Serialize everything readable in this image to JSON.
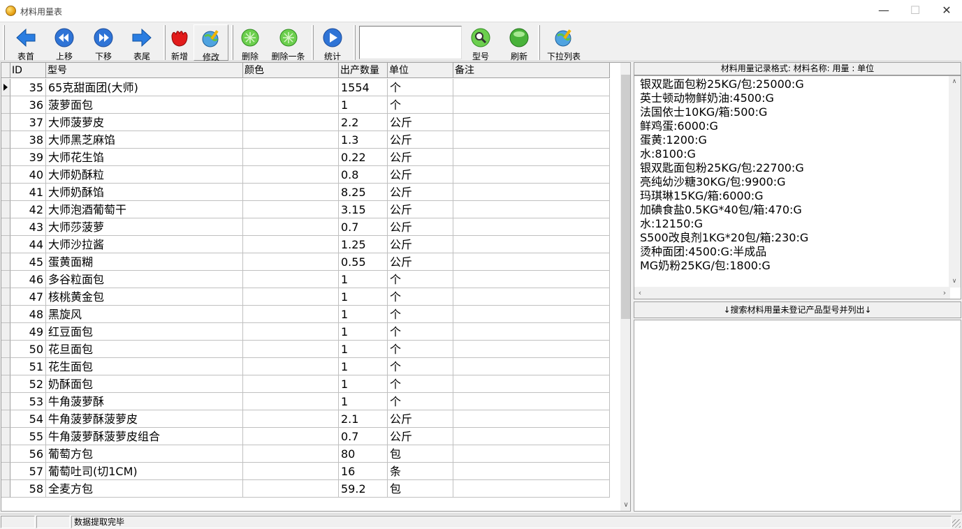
{
  "window": {
    "title": "材料用量表"
  },
  "toolbar": {
    "buttons": [
      {
        "label": "表首"
      },
      {
        "label": "上移"
      },
      {
        "label": "下移"
      },
      {
        "label": "表尾"
      },
      {
        "label": "新增"
      },
      {
        "label": "修改"
      },
      {
        "label": "删除"
      },
      {
        "label": "删除一条"
      },
      {
        "label": "统计"
      },
      {
        "label": "型号"
      },
      {
        "label": "刷新"
      },
      {
        "label": "下拉列表"
      }
    ],
    "search_value": ""
  },
  "grid": {
    "columns": [
      "ID",
      "型号",
      "颜色",
      "出产数量",
      "单位",
      "备注"
    ],
    "rows": [
      {
        "id": "35",
        "model": "65克甜面团(大师)",
        "color": "",
        "qty": "1554",
        "unit": "个",
        "note": ""
      },
      {
        "id": "36",
        "model": "菠萝面包",
        "color": "",
        "qty": "1",
        "unit": "个",
        "note": ""
      },
      {
        "id": "37",
        "model": "大师菠萝皮",
        "color": "",
        "qty": "2.2",
        "unit": "公斤",
        "note": ""
      },
      {
        "id": "38",
        "model": "大师黑芝麻馅",
        "color": "",
        "qty": "1.3",
        "unit": "公斤",
        "note": ""
      },
      {
        "id": "39",
        "model": "大师花生馅",
        "color": "",
        "qty": "0.22",
        "unit": "公斤",
        "note": ""
      },
      {
        "id": "40",
        "model": "大师奶酥粒",
        "color": "",
        "qty": "0.8",
        "unit": "公斤",
        "note": ""
      },
      {
        "id": "41",
        "model": "大师奶酥馅",
        "color": "",
        "qty": "8.25",
        "unit": "公斤",
        "note": ""
      },
      {
        "id": "42",
        "model": "大师泡酒葡萄干",
        "color": "",
        "qty": "3.15",
        "unit": "公斤",
        "note": ""
      },
      {
        "id": "43",
        "model": "大师莎菠萝",
        "color": "",
        "qty": "0.7",
        "unit": "公斤",
        "note": ""
      },
      {
        "id": "44",
        "model": "大师沙拉酱",
        "color": "",
        "qty": "1.25",
        "unit": "公斤",
        "note": ""
      },
      {
        "id": "45",
        "model": "蛋黄面糊",
        "color": "",
        "qty": "0.55",
        "unit": "公斤",
        "note": ""
      },
      {
        "id": "46",
        "model": "多谷粒面包",
        "color": "",
        "qty": "1",
        "unit": "个",
        "note": ""
      },
      {
        "id": "47",
        "model": "核桃黄金包",
        "color": "",
        "qty": "1",
        "unit": "个",
        "note": ""
      },
      {
        "id": "48",
        "model": "黑旋风",
        "color": "",
        "qty": "1",
        "unit": "个",
        "note": ""
      },
      {
        "id": "49",
        "model": "红豆面包",
        "color": "",
        "qty": "1",
        "unit": "个",
        "note": ""
      },
      {
        "id": "50",
        "model": "花旦面包",
        "color": "",
        "qty": "1",
        "unit": "个",
        "note": ""
      },
      {
        "id": "51",
        "model": "花生面包",
        "color": "",
        "qty": "1",
        "unit": "个",
        "note": ""
      },
      {
        "id": "52",
        "model": "奶酥面包",
        "color": "",
        "qty": "1",
        "unit": "个",
        "note": ""
      },
      {
        "id": "53",
        "model": "牛角菠萝酥",
        "color": "",
        "qty": "1",
        "unit": "个",
        "note": ""
      },
      {
        "id": "54",
        "model": "牛角菠萝酥菠萝皮",
        "color": "",
        "qty": "2.1",
        "unit": "公斤",
        "note": ""
      },
      {
        "id": "55",
        "model": "牛角菠萝酥菠萝皮组合",
        "color": "",
        "qty": "0.7",
        "unit": "公斤",
        "note": ""
      },
      {
        "id": "56",
        "model": "葡萄方包",
        "color": "",
        "qty": "80",
        "unit": "包",
        "note": ""
      },
      {
        "id": "57",
        "model": "葡萄吐司(切1CM)",
        "color": "",
        "qty": "16",
        "unit": "条",
        "note": ""
      },
      {
        "id": "58",
        "model": "全麦方包",
        "color": "",
        "qty": "59.2",
        "unit": "包",
        "note": ""
      }
    ],
    "current_row_index": 0
  },
  "memo_panel": {
    "title": "材料用量记录格式: 材料名称: 用量 : 单位",
    "lines": [
      "银双匙面包粉25KG/包:25000:G",
      "英士顿动物鲜奶油:4500:G",
      "法国依士10KG/箱:500:G",
      "鲜鸡蛋:6000:G",
      "蛋黄:1200:G",
      "水:8100:G",
      "银双匙面包粉25KG/包:22700:G",
      "亮纯幼沙糖30KG/包:9900:G",
      "玛琪琳15KG/箱:6000:G",
      "加碘食盐0.5KG*40包/箱:470:G",
      "水:12150:G",
      "S500改良剂1KG*20包/箱:230:G",
      "烫种面团:4500:G:半成品",
      "MG奶粉25KG/包:1800:G"
    ]
  },
  "search_panel": {
    "title": "↓搜索材料用量未登记产品型号并列出↓"
  },
  "statusbar": {
    "panel1": "",
    "panel2": "",
    "message": "数据提取完毕"
  }
}
